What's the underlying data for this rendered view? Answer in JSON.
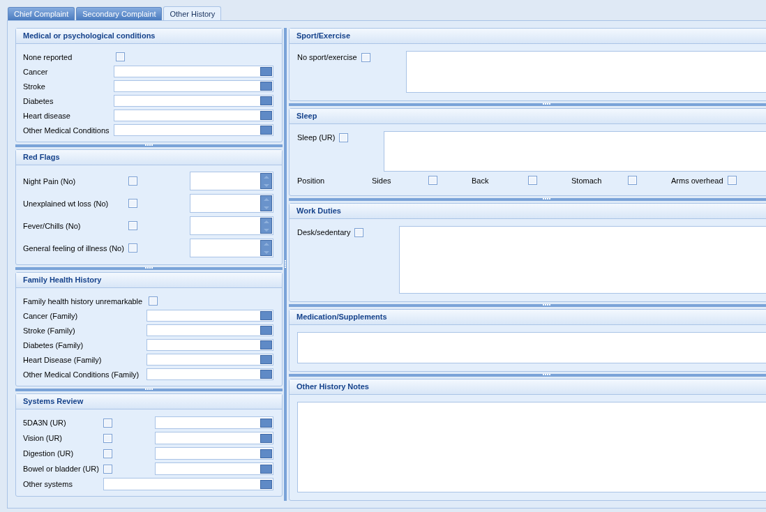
{
  "tabs": [
    {
      "label": "Chief Complaint",
      "selected": false
    },
    {
      "label": "Secondary Complaint",
      "selected": false
    },
    {
      "label": "Other History",
      "selected": true
    }
  ],
  "left_panels": [
    {
      "title": "Medical or psychological conditions",
      "fields": [
        {
          "kind": "check",
          "label": "None reported",
          "checked": false
        },
        {
          "kind": "combo",
          "label": "Cancer"
        },
        {
          "kind": "combo",
          "label": "Stroke"
        },
        {
          "kind": "combo",
          "label": "Diabetes"
        },
        {
          "kind": "combo",
          "label": "Heart disease"
        },
        {
          "kind": "combo",
          "label": "Other Medical Conditions"
        }
      ]
    },
    {
      "title": "Red Flags",
      "fields": [
        {
          "kind": "check_spin",
          "label": "Night Pain (No)",
          "checked": false
        },
        {
          "kind": "check_spin",
          "label": "Unexplained wt loss (No)",
          "checked": false
        },
        {
          "kind": "check_spin",
          "label": "Fever/Chills (No)",
          "checked": false
        },
        {
          "kind": "check_spin",
          "label": "General feeling of illness (No)",
          "checked": false
        }
      ]
    },
    {
      "title": "Family Health History",
      "fields": [
        {
          "kind": "check",
          "label": "Family health history unremarkable",
          "checked": false
        },
        {
          "kind": "combo",
          "label": "Cancer (Family)"
        },
        {
          "kind": "combo",
          "label": "Stroke (Family)"
        },
        {
          "kind": "combo",
          "label": "Diabetes (Family)"
        },
        {
          "kind": "combo",
          "label": "Heart Disease (Family)"
        },
        {
          "kind": "combo",
          "label": "Other Medical Conditions (Family)"
        }
      ]
    },
    {
      "title": "Systems Review",
      "fields": [
        {
          "kind": "check_combo",
          "label": "5DA3N (UR)",
          "checked": false
        },
        {
          "kind": "check_combo",
          "label": "Vision (UR)",
          "checked": false
        },
        {
          "kind": "check_combo",
          "label": "Digestion (UR)",
          "checked": false
        },
        {
          "kind": "check_combo",
          "label": "Bowel or bladder (UR)",
          "checked": false
        },
        {
          "kind": "combo",
          "label": "Other systems"
        }
      ]
    }
  ],
  "right_panels": [
    {
      "title": "Sport/Exercise",
      "fields": [
        {
          "kind": "check_memo",
          "label": "No sport/exercise",
          "checked": false
        }
      ]
    },
    {
      "title": "Sleep",
      "fields": [
        {
          "kind": "check_memo",
          "label": "Sleep (UR)",
          "checked": false
        },
        {
          "kind": "options",
          "label": "Position",
          "options": [
            {
              "label": "Sides",
              "checked": false
            },
            {
              "label": "Back",
              "checked": false
            },
            {
              "label": "Stomach",
              "checked": false
            },
            {
              "label": "Arms overhead",
              "checked": false
            }
          ]
        }
      ]
    },
    {
      "title": "Work Duties",
      "fields": [
        {
          "kind": "check_memo",
          "label": "Desk/sedentary",
          "checked": false
        }
      ]
    },
    {
      "title": "Medication/Supplements",
      "fields": [
        {
          "kind": "memo"
        }
      ]
    },
    {
      "title": "Other History Notes",
      "fields": [
        {
          "kind": "memo"
        }
      ]
    }
  ]
}
